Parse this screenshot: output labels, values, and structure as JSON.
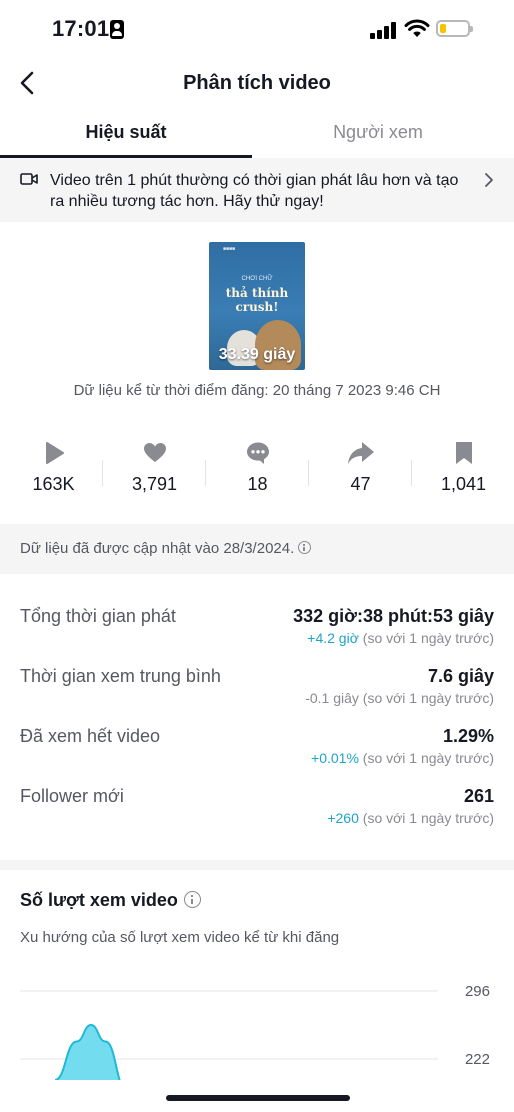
{
  "status_bar": {
    "time": "17:01",
    "battery_level": 0.2
  },
  "header": {
    "title": "Phân tích video",
    "back_icon": "chevron-left-icon"
  },
  "tabs": [
    {
      "label": "Hiệu suất",
      "active": true
    },
    {
      "label": "Người xem",
      "active": false
    }
  ],
  "banner": {
    "icon": "video-camera-icon",
    "text": "Video trên 1 phút thường có thời gian phát lâu hơn và tạo ra nhiều tương tác hơn. Hãy thử ngay!"
  },
  "video": {
    "duration": "33.39 giây",
    "thumbnail_small_text": "CHƠI CHỮ",
    "thumbnail_big_text": "thả thính crush!",
    "posted_label": "Dữ liệu kể từ thời điểm đăng: 20 tháng 7 2023 9:46 CH"
  },
  "stats": [
    {
      "icon": "play-icon",
      "value": "163K"
    },
    {
      "icon": "heart-icon",
      "value": "3,791"
    },
    {
      "icon": "comment-icon",
      "value": "18"
    },
    {
      "icon": "share-icon",
      "value": "47"
    },
    {
      "icon": "bookmark-icon",
      "value": "1,041"
    }
  ],
  "updated_notice": "Dữ liệu đã được cập nhật vào 28/3/2024.",
  "metrics": [
    {
      "label": "Tổng thời gian phát",
      "value": "332 giờ:38 phút:53 giây",
      "change": "+4.2 giờ",
      "compare": "(so với 1 ngày trước)",
      "change_color": "#1da4c9"
    },
    {
      "label": "Thời gian xem trung bình",
      "value": "7.6 giây",
      "change": "-0.1 giây",
      "compare": "(so với 1 ngày trước)",
      "change_color": "#8a8b91"
    },
    {
      "label": "Đã xem hết video",
      "value": "1.29%",
      "change": "+0.01%",
      "compare": "(so với 1 ngày trước)",
      "change_color": "#1da4c9"
    },
    {
      "label": "Follower mới",
      "value": "261",
      "change": "+260",
      "compare": "(so với 1 ngày trước)",
      "change_color": "#1da4c9"
    }
  ],
  "views_section": {
    "title": "Số lượt xem video",
    "subtitle": "Xu hướng của số lượt xem video kể từ khi đăng"
  },
  "chart_data": {
    "type": "area",
    "ytick_labels": [
      "296",
      "222"
    ],
    "grid": true,
    "series_color": "#5ad7ec",
    "points": [
      {
        "x": 0,
        "y": 150
      },
      {
        "x": 0.6,
        "y": 255
      },
      {
        "x": 1,
        "y": 300
      },
      {
        "x": 1.4,
        "y": 255
      },
      {
        "x": 2,
        "y": 120
      }
    ],
    "ylim": [
      150,
      300
    ]
  },
  "colors": {
    "accent": "#1da4c9",
    "text_primary": "#161823",
    "text_secondary": "#8a8b91"
  }
}
